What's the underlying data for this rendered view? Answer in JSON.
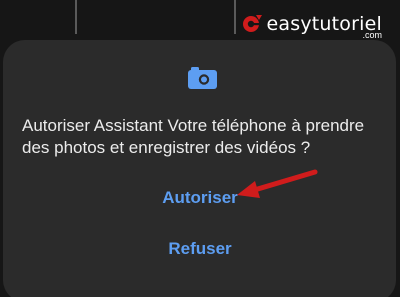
{
  "watermark": {
    "brand": "easytutoriel",
    "suffix": ".com"
  },
  "dialog": {
    "icon": "camera-icon",
    "message": "Autoriser Assistant Votre téléphone à prendre des photos et enregistrer des vidéos ?",
    "allow_label": "Autoriser",
    "deny_label": "Refuser"
  },
  "colors": {
    "accent": "#5d9ef2",
    "dialog_bg": "#2b2b2b",
    "annotation_arrow": "#d01c1c"
  }
}
